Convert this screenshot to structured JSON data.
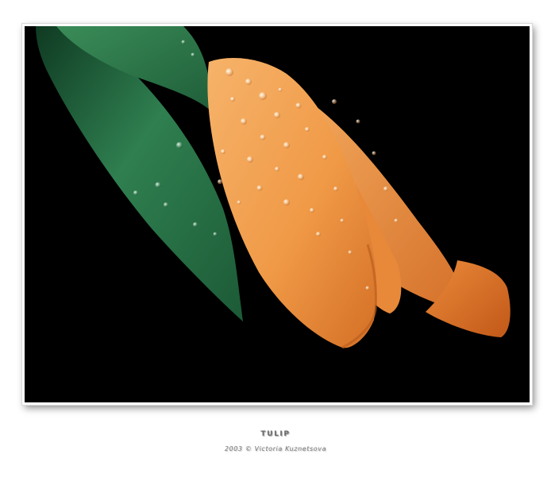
{
  "caption": {
    "title": "TULIP",
    "credit": "2003 © Victoria Kuznetsova"
  },
  "photo": {
    "background_color": "#000000",
    "petal_color": "#f2a24e",
    "petal_shadow_color": "#c8611c",
    "leaf_color": "#2e7a4c",
    "leaf_dark_color": "#15422a",
    "frame_color": "#ffffff"
  }
}
